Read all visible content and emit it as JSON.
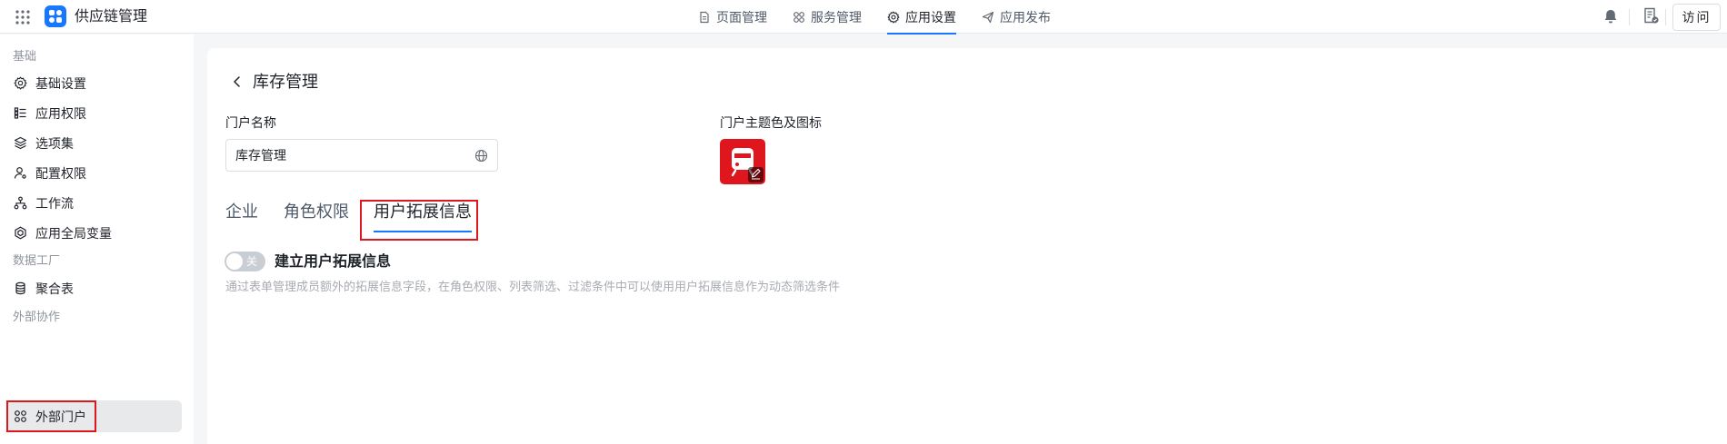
{
  "app": {
    "name": "供应链管理",
    "accent": "#1677ff",
    "grid_icon": "grid-icon",
    "logo_icon": "app-logo-icon"
  },
  "nav": {
    "items": [
      {
        "label": "页面管理",
        "icon": "page-icon"
      },
      {
        "label": "服务管理",
        "icon": "service-icon"
      },
      {
        "label": "应用设置",
        "icon": "settings-icon",
        "active": true
      },
      {
        "label": "应用发布",
        "icon": "send-icon"
      }
    ]
  },
  "header_right": {
    "bell_icon": "bell-icon",
    "doc_icon": "document-icon",
    "visit_label": "访问"
  },
  "sidebar": {
    "groups": [
      {
        "title": "基础",
        "items": [
          {
            "label": "基础设置",
            "icon": "gear-icon"
          },
          {
            "label": "应用权限",
            "icon": "list-icon"
          },
          {
            "label": "选项集",
            "icon": "layers-icon"
          },
          {
            "label": "配置权限",
            "icon": "user-key-icon"
          },
          {
            "label": "工作流",
            "icon": "workflow-icon"
          },
          {
            "label": "应用全局变量",
            "icon": "hexagon-icon"
          }
        ]
      },
      {
        "title": "数据工厂",
        "items": [
          {
            "label": "聚合表",
            "icon": "database-icon"
          }
        ]
      },
      {
        "title": "外部协作",
        "items": [
          {
            "label": "外部门户",
            "icon": "apps-icon",
            "active": true
          }
        ]
      }
    ]
  },
  "main": {
    "back_icon": "back-icon",
    "title": "库存管理",
    "portal_name_label": "门户名称",
    "portal_name_value": "库存管理",
    "globe_icon": "globe-icon",
    "theme_label": "门户主题色及图标",
    "theme_color": "#e0161e",
    "portal_icon": "bus-icon",
    "tabs": [
      {
        "label": "企业"
      },
      {
        "label": "角色权限"
      },
      {
        "label": "用户拓展信息",
        "active": true
      }
    ],
    "switch_state": "关",
    "switch_on": false,
    "ext_title": "建立用户拓展信息",
    "ext_desc": "通过表单管理成员额外的拓展信息字段，在角色权限、列表筛选、过滤条件中可以使用用户拓展信息作为动态筛选条件"
  }
}
